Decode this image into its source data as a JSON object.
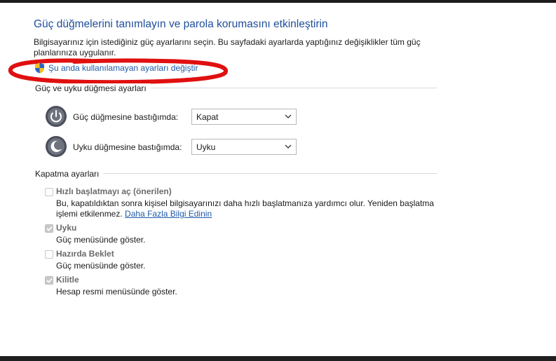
{
  "header": {
    "title": "Güç düğmelerini tanımlayın ve parola korumasını etkinleştirin",
    "description": "Bilgisayarınız için istediğiniz güç ayarlarını seçin. Bu sayfadaki ayarlarda yaptığınız değişiklikler tüm güç planlarınıza uygulanır.",
    "change_link": "Şu anda kullanılamayan ayarları değiştir"
  },
  "power_buttons": {
    "section_title": "Güç ve uyku düğmesi ayarları",
    "rows": [
      {
        "icon": "power-icon",
        "label": "Güç düğmesine bastığımda:",
        "value": "Kapat"
      },
      {
        "icon": "sleep-icon",
        "label": "Uyku düğmesine bastığımda:",
        "value": "Uyku"
      }
    ]
  },
  "shutdown": {
    "section_title": "Kapatma ayarları",
    "options": [
      {
        "label": "Hızlı başlatmayı aç (önerilen)",
        "checked": false,
        "desc": "Bu, kapatıldıktan sonra kişisel bilgisayarınızı daha hızlı başlatmanıza yardımcı olur. Yeniden başlatma işlemi etkilenmez.",
        "link": "Daha Fazla Bilgi Edinin"
      },
      {
        "label": "Uyku",
        "checked": true,
        "desc": "Güç menüsünde göster."
      },
      {
        "label": "Hazırda Beklet",
        "checked": false,
        "desc": "Güç menüsünde göster."
      },
      {
        "label": "Kilitle",
        "checked": true,
        "desc": "Hesap resmi menüsünde göster."
      }
    ]
  },
  "colors": {
    "title": "#1f4e9b",
    "link": "#1e5aa8",
    "annotation": "#e01010"
  }
}
